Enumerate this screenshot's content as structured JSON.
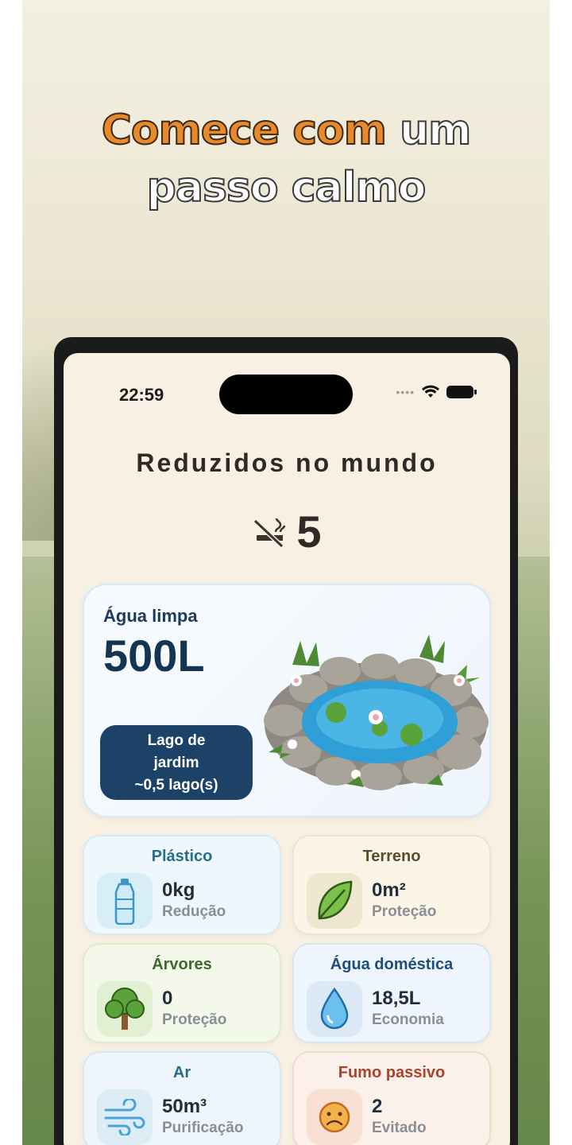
{
  "headline": {
    "highlight": "Comece com",
    "rest_line1": " um",
    "line2": "passo calmo"
  },
  "status": {
    "time": "22:59"
  },
  "screen": {
    "title": "Reduzidos no mundo",
    "count": "5",
    "water": {
      "label": "Água limpa",
      "value": "500L",
      "badge_line1": "Lago de",
      "badge_line2": "jardim",
      "badge_line3": "~0,5 lago(s)"
    },
    "tiles": [
      {
        "title": "Plástico",
        "value": "0kg",
        "sub": "Redução",
        "icon": "bottle-icon"
      },
      {
        "title": "Terreno",
        "value": "0m²",
        "sub": "Proteção",
        "icon": "leaf-icon"
      },
      {
        "title": "Árvores",
        "value": "0",
        "sub": "Proteção",
        "icon": "tree-icon"
      },
      {
        "title": "Água doméstica",
        "value": "18,5L",
        "sub": "Economia",
        "icon": "water-drop-icon"
      },
      {
        "title": "Ar",
        "value": "50m³",
        "sub": "Purificação",
        "icon": "wind-icon"
      },
      {
        "title": "Fumo passivo",
        "value": "2",
        "sub": "Evitado",
        "icon": "sad-face-icon"
      }
    ]
  }
}
